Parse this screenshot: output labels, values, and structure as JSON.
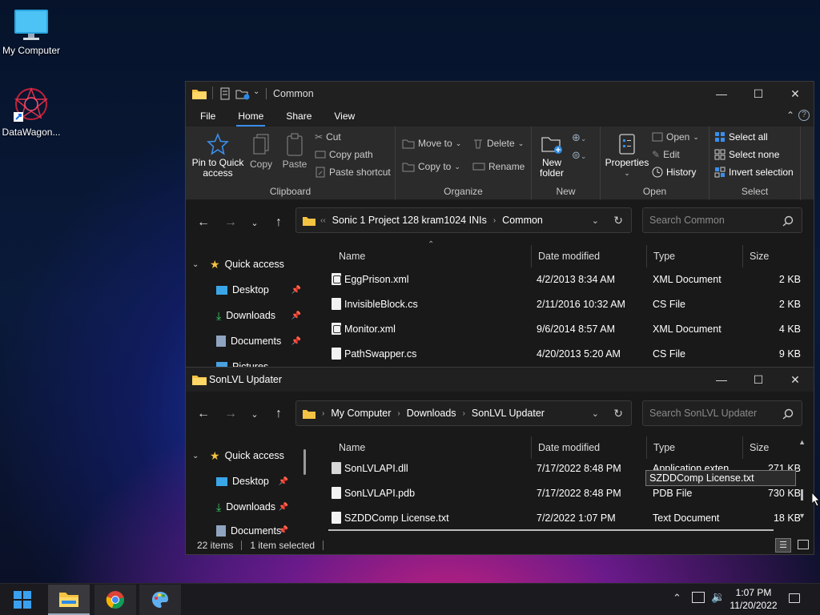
{
  "desktop": {
    "icons": [
      {
        "label": "My Computer"
      },
      {
        "label": "DataWagon..."
      }
    ]
  },
  "common_window": {
    "title": "Common",
    "menus": [
      "File",
      "Home",
      "Share",
      "View"
    ],
    "ribbon": {
      "clipboard": {
        "pin_label": "Pin to Quick access",
        "copy_label": "Copy",
        "paste_label": "Paste",
        "cut_label": "Cut",
        "copy_path_label": "Copy path",
        "paste_shortcut_label": "Paste shortcut",
        "group_label": "Clipboard"
      },
      "organize": {
        "move_to_label": "Move to",
        "copy_to_label": "Copy to",
        "delete_label": "Delete",
        "rename_label": "Rename",
        "group_label": "Organize"
      },
      "new": {
        "new_folder_label": "New folder",
        "group_label": "New"
      },
      "open": {
        "properties_label": "Properties",
        "open_label": "Open",
        "edit_label": "Edit",
        "history_label": "History",
        "group_label": "Open"
      },
      "select": {
        "select_all_label": "Select all",
        "select_none_label": "Select none",
        "invert_label": "Invert selection",
        "group_label": "Select"
      }
    },
    "address": {
      "parts": [
        "Sonic 1 Project 128 kram1024 INIs",
        "Common"
      ]
    },
    "search_placeholder": "Search Common",
    "nav": {
      "quick_access": "Quick access",
      "items": [
        "Desktop",
        "Downloads",
        "Documents",
        "Pictures"
      ]
    },
    "columns": [
      "Name",
      "Date modified",
      "Type",
      "Size"
    ],
    "files": [
      {
        "name": "EggPrison.xml",
        "date": "4/2/2013 8:34 AM",
        "type": "XML Document",
        "size": "2 KB",
        "kind": "xml"
      },
      {
        "name": "InvisibleBlock.cs",
        "date": "2/11/2016 10:32 AM",
        "type": "CS File",
        "size": "2 KB",
        "kind": "file"
      },
      {
        "name": "Monitor.xml",
        "date": "9/6/2014 8:57 AM",
        "type": "XML Document",
        "size": "4 KB",
        "kind": "xml"
      },
      {
        "name": "PathSwapper.cs",
        "date": "4/20/2013 5:20 AM",
        "type": "CS File",
        "size": "9 KB",
        "kind": "file"
      }
    ]
  },
  "updater_window": {
    "title": "SonLVL Updater",
    "address": {
      "parts": [
        "My Computer",
        "Downloads",
        "SonLVL Updater"
      ]
    },
    "search_placeholder": "Search SonLVL Updater",
    "nav": {
      "quick_access": "Quick access",
      "items": [
        "Desktop",
        "Downloads",
        "Documents"
      ]
    },
    "columns": [
      "Name",
      "Date modified",
      "Type",
      "Size"
    ],
    "files": [
      {
        "name": "SonLVLAPI.dll",
        "date": "7/17/2022 8:48 PM",
        "type": "Application exten...",
        "size": "271 KB",
        "kind": "dll"
      },
      {
        "name": "SonLVLAPI.pdb",
        "date": "7/17/2022 8:48 PM",
        "type": "PDB File",
        "size": "730 KB",
        "kind": "file"
      },
      {
        "name": "SZDDComp License.txt",
        "date": "7/2/2022 1:07 PM",
        "type": "Text Document",
        "size": "18 KB",
        "kind": "txt"
      }
    ],
    "tooltip": "SZDDComp License.txt",
    "status": {
      "items": "22 items",
      "selected": "1 item selected"
    }
  },
  "taskbar": {
    "time": "1:07 PM",
    "date": "11/20/2022"
  },
  "colors": {
    "accent": "#3b8eea",
    "folder": "#f5c342"
  }
}
